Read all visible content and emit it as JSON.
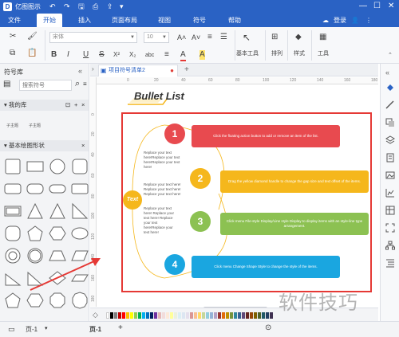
{
  "titlebar": {
    "app_name": "亿图图示",
    "undo": "↶",
    "redo": "↷",
    "save": "🖫",
    "print": "⎙",
    "export": "⇪",
    "more": "▾",
    "minimize": "—",
    "maximize": "☐",
    "close": "✕"
  },
  "menu": {
    "tabs": [
      "文件",
      "开始",
      "插入",
      "页面布局",
      "视图",
      "符号",
      "帮助"
    ],
    "active": "开始",
    "login": "登录",
    "icons": {
      "cloud": "☁",
      "user": "👤",
      "share": "⋮"
    }
  },
  "ribbon": {
    "font_name": "宋体",
    "font_size": "10",
    "basic_tools": "基本工具",
    "arrange": "排列",
    "style": "样式",
    "tools": "工具",
    "format_buttons": [
      "B",
      "I",
      "U",
      "S",
      "X²",
      "X₂",
      "abc",
      "≡",
      "A",
      "A"
    ]
  },
  "left_panel": {
    "title": "符号库",
    "search_placeholder": "搜索符号",
    "my_library": "我的库",
    "basic_shapes": "基本绘图形状",
    "saved_items": [
      "子主题",
      "子主题"
    ]
  },
  "document": {
    "tab_name": "项目符号清单2",
    "ruler_labels": [
      "0",
      "20",
      "40",
      "60",
      "80",
      "100",
      "120",
      "140",
      "160",
      "180"
    ],
    "title": "Bullet List",
    "left_label": "Text",
    "left_texts": [
      "Replace your text here!Replace your text here!Replace your text here!",
      "Replace your text here! Replace your text here! Replace your text here!",
      "Replace your text here! Replace your text here! Replace your text here!Replace your text here!"
    ],
    "items": [
      {
        "num": "1",
        "color": "#e84a4f",
        "text": "Click the floating action button to add or remove an item of the list."
      },
      {
        "num": "2",
        "color": "#f5b71c",
        "text": "Drag the yellow diamond handle to change the gap size and text offset of the items."
      },
      {
        "num": "3",
        "color": "#8cc152",
        "text": "Click menu File-style Display/Line style Display to display items with an style-line type arrangement."
      },
      {
        "num": "4",
        "color": "#1aa6e0",
        "text": "Click menu Change Shape Style to change the style of the items."
      }
    ]
  },
  "status": {
    "page_tab": "页-1",
    "page_active": "页-1",
    "add": "+",
    "watermark": "软件技巧"
  },
  "palette": [
    "#ffffff",
    "#000000",
    "#7f7f7f",
    "#c00000",
    "#ff0000",
    "#ffc000",
    "#ffff00",
    "#92d050",
    "#00b050",
    "#00b0f0",
    "#0070c0",
    "#002060",
    "#7030a0",
    "#e6b8b7",
    "#f2dcdb",
    "#fde9d9",
    "#ffff99",
    "#ebf1de",
    "#dbeef4",
    "#dce6f2",
    "#e4dfec",
    "#d99694",
    "#fabf8f",
    "#ffd966",
    "#c4d79b",
    "#92cddc",
    "#95b3d7",
    "#b3a2c7",
    "#963634",
    "#e26b0a",
    "#bf8f00",
    "#76933c",
    "#31869b",
    "#366092",
    "#60497a",
    "#632523",
    "#974706",
    "#7f6000",
    "#4f6228",
    "#215967",
    "#244062",
    "#3f3151"
  ]
}
